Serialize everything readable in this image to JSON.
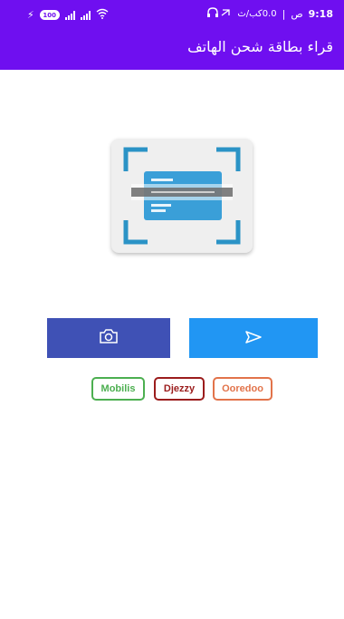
{
  "status_bar": {
    "battery": "100",
    "time": "9:18",
    "period": "ص",
    "speed": "0.0كب/ث"
  },
  "app_bar": {
    "title": "قراء بطاقة شحن الهاتف"
  },
  "scanner": {
    "icon": "card-scan-icon"
  },
  "buttons": {
    "camera_icon": "camera-icon",
    "send_icon": "send-icon",
    "camera_color": "#3f51b5",
    "send_color": "#2196f3"
  },
  "operators": [
    {
      "label": "Mobilis",
      "color": "#4caf50"
    },
    {
      "label": "Djezzy",
      "color": "#9b1c1c"
    },
    {
      "label": "Ooredoo",
      "color": "#e2734a"
    }
  ],
  "theme": {
    "app_bar_color": "#6f0ff0"
  }
}
